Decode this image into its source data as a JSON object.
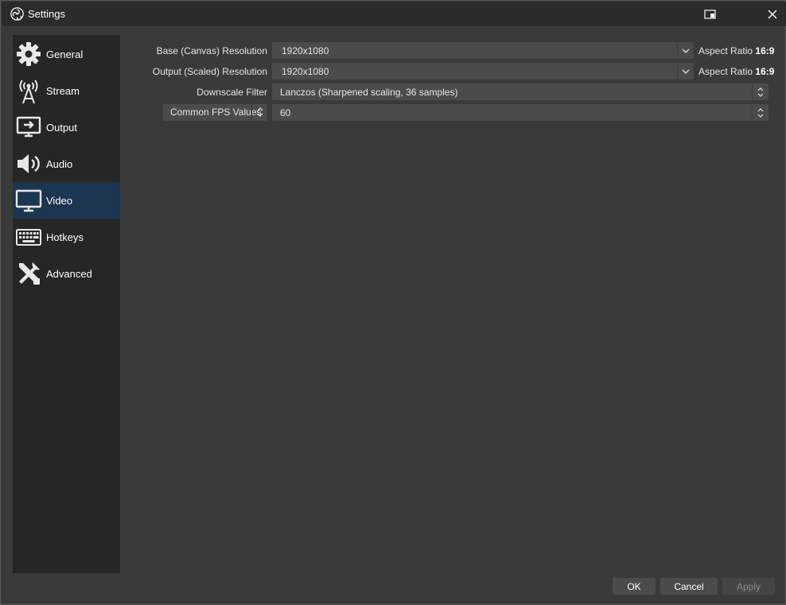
{
  "window": {
    "title": "Settings",
    "app_icon": "obs-logo-icon",
    "buttons": [
      "popout-icon",
      "close-icon"
    ]
  },
  "sidebar": {
    "items": [
      {
        "label": "General",
        "icon": "gear-icon",
        "active": false
      },
      {
        "label": "Stream",
        "icon": "antenna-icon",
        "active": false
      },
      {
        "label": "Output",
        "icon": "output-icon",
        "active": false
      },
      {
        "label": "Audio",
        "icon": "speaker-icon",
        "active": false
      },
      {
        "label": "Video",
        "icon": "monitor-icon",
        "active": true
      },
      {
        "label": "Hotkeys",
        "icon": "keyboard-icon",
        "active": false
      },
      {
        "label": "Advanced",
        "icon": "tools-icon",
        "active": false
      }
    ]
  },
  "video": {
    "base_resolution": {
      "label": "Base (Canvas) Resolution",
      "value": "1920x1080",
      "aspect_prefix": "Aspect Ratio",
      "aspect_value": "16:9"
    },
    "output_resolution": {
      "label": "Output (Scaled) Resolution",
      "value": "1920x1080",
      "aspect_prefix": "Aspect Ratio",
      "aspect_value": "16:9"
    },
    "downscale_filter": {
      "label": "Downscale Filter",
      "value": "Lanczos (Sharpened scaling, 36 samples)"
    },
    "fps": {
      "type_label": "Common FPS Values",
      "value": "60"
    }
  },
  "footer": {
    "ok_label": "OK",
    "cancel_label": "Cancel",
    "apply_label": "Apply",
    "apply_enabled": false
  },
  "colors": {
    "window_bg": "#3a3a3a",
    "sidebar_bg": "#262626",
    "active_item_bg": "#1c3550",
    "input_bg": "#4b4b4b"
  }
}
